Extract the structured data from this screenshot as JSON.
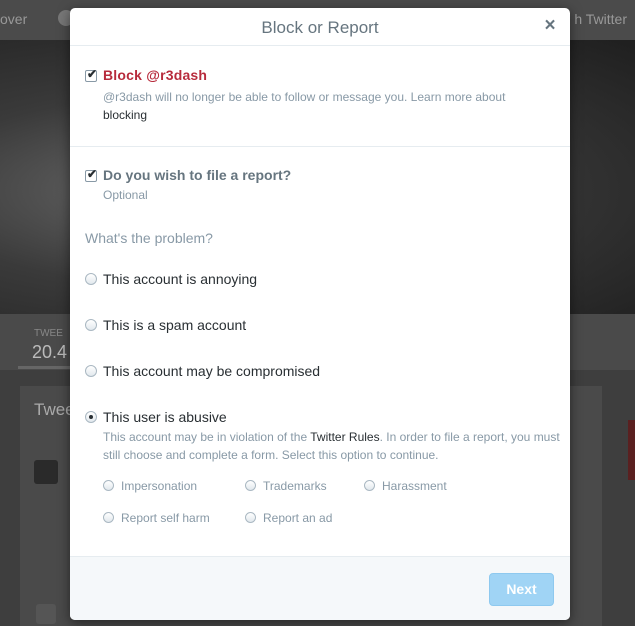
{
  "background": {
    "nav_left": "over",
    "nav_right": "h Twitter",
    "stats_label": "TWEE",
    "stats_value": "20.4",
    "card_title": "Twee"
  },
  "modal": {
    "title": "Block or Report",
    "close_icon": "×",
    "block": {
      "checked": true,
      "title": "Block @r3dash",
      "desc_prefix": "@r3dash will no longer be able to follow or message you. Learn more about",
      "desc_link": "blocking"
    },
    "report": {
      "checked": true,
      "title": "Do you wish to file a report?",
      "subtitle": "Optional"
    },
    "problem_question": "What's the problem?",
    "options": [
      {
        "label": "This account is annoying",
        "checked": false
      },
      {
        "label": "This is a spam account",
        "checked": false
      },
      {
        "label": "This account may be compromised",
        "checked": false
      },
      {
        "label": "This user is abusive",
        "checked": true
      }
    ],
    "abusive_desc": {
      "part1": "This account may be in violation of the",
      "link": "Twitter Rules",
      "part2": ". In order to file a report, you must still choose and complete a form. Select this option to continue."
    },
    "sub_options": [
      "Impersonation",
      "Trademarks",
      "Harassment",
      "Report self harm",
      "Report an ad"
    ],
    "next_label": "Next"
  },
  "colors": {
    "accent_red": "#b72b3c",
    "next_button": "#a0d4f5"
  }
}
